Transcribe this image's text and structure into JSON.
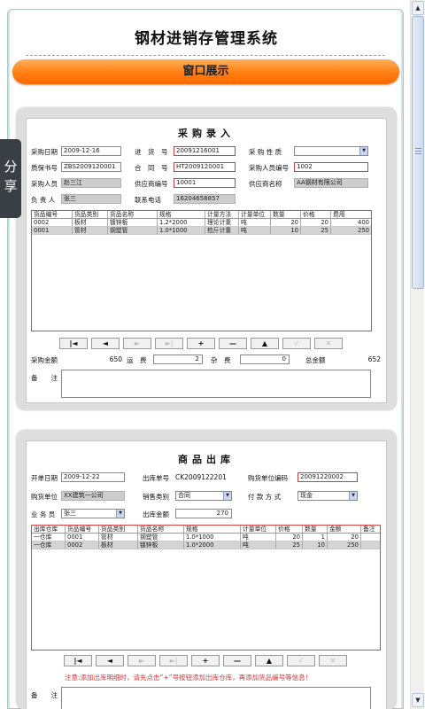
{
  "app_title": "钢材进销存管理系统",
  "banner_label": "窗口展示",
  "share_label": "分享",
  "scrollbar": {
    "up": "▲",
    "down": "▼"
  },
  "purchase": {
    "title": "采购录入",
    "labels": {
      "date": "采购日期",
      "order_no": "进　货　号",
      "nature": "采 购 性 质",
      "warranty": "质保书号",
      "contract": "合　同　号",
      "buyer_code": "采购人员编号",
      "buyer": "采购人员",
      "supplier_code": "供应商编号",
      "supplier_name": "供应商名称",
      "manager": "负 责 人",
      "phone": "联系电话",
      "amount": "采购金额",
      "freight": "运　费",
      "misc": "杂　费",
      "total": "总金额",
      "remark": "备　　注"
    },
    "values": {
      "date": "2009-12-16",
      "order_no": "20091216001",
      "nature": "",
      "warranty": "ZBS2009120001",
      "contract": "HT2009120001",
      "buyer_code": "1002",
      "buyer": "赵三江",
      "supplier_code": "10001",
      "supplier_name": "AA钢材有限公司",
      "manager": "张三",
      "phone": "16204658857",
      "amount": "650",
      "freight": "2",
      "misc": "0",
      "total": "652"
    },
    "columns": [
      "货品编号",
      "货品类别",
      "货品名称",
      "规格",
      "计量方法",
      "计量单位",
      "数量",
      "价格",
      "费用"
    ],
    "rows": [
      [
        "0002",
        "板材",
        "镀锌板",
        "1.2*2000",
        "理论计重",
        "吨",
        "20",
        "20",
        "400"
      ],
      [
        "0001",
        "管材",
        "钢塑管",
        "1.0*1000",
        "检斤计重",
        "吨",
        "10",
        "25",
        "250"
      ]
    ]
  },
  "outbound": {
    "title": "商品出库",
    "labels": {
      "date": "开单日期",
      "out_no": "出库单号",
      "buyer_code": "购货单位编码",
      "buyer_unit": "购货单位",
      "sales_type": "销售类别",
      "pay_type": "付 款 方 式",
      "salesman": "业 务 员",
      "amount": "出库金额",
      "remark": "备　　注"
    },
    "values": {
      "date": "2009-12-22",
      "out_no": "CK2009122201",
      "buyer_code": "20091220002",
      "buyer_unit": "XX建筑一公司",
      "sales_type": "合同",
      "pay_type": "现金",
      "salesman": "张三",
      "amount": "270"
    },
    "columns": [
      "出库仓库",
      "货品编号",
      "货品类别",
      "货品名称",
      "规格",
      "计量单位",
      "价格",
      "数量",
      "金额",
      "备注"
    ],
    "rows": [
      [
        "一仓库",
        "0001",
        "管材",
        "钢塑管",
        "1.0*1000",
        "吨",
        "20",
        "1",
        "20",
        ""
      ],
      [
        "一仓库",
        "0002",
        "板材",
        "镀锌板",
        "1.0*2000",
        "吨",
        "25",
        "10",
        "250",
        ""
      ]
    ],
    "note": "注意:添加出库明细时，请先点击“+”号按钮添加出库仓库，再添加货品编号等信息！"
  },
  "nav_buttons": [
    "|◄",
    "◄",
    "►",
    "►|",
    "+",
    "—",
    "▲",
    "✓",
    "✕"
  ]
}
